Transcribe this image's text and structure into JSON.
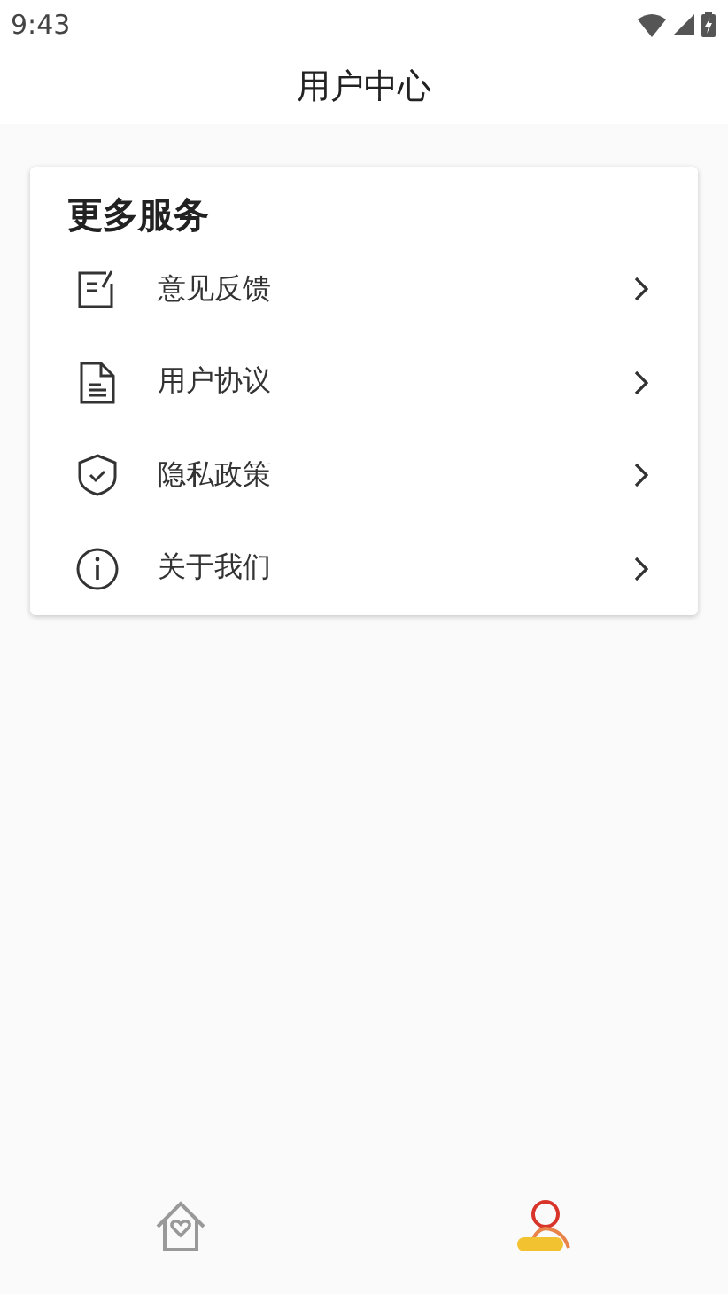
{
  "status_bar": {
    "time": "9:43"
  },
  "header": {
    "title": "用户中心"
  },
  "card": {
    "title": "更多服务",
    "items": [
      {
        "label": "意见反馈",
        "kind": "feedback"
      },
      {
        "label": "用户协议",
        "kind": "document"
      },
      {
        "label": "隐私政策",
        "kind": "shield"
      },
      {
        "label": "关于我们",
        "kind": "info"
      }
    ]
  },
  "tabs": [
    {
      "kind": "home",
      "selected": false
    },
    {
      "kind": "user",
      "selected": true
    }
  ]
}
